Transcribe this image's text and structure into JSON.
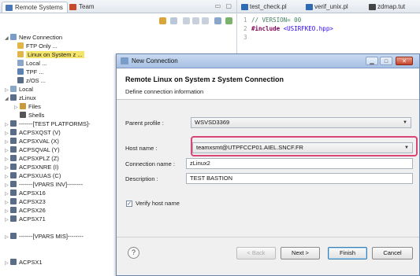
{
  "left_panel": {
    "tabs": [
      "Remote Systems",
      "Team"
    ],
    "tree": [
      {
        "label": "New Connection",
        "icon": "connection-icon"
      },
      {
        "label": "FTP Only ...",
        "icon": "folder-icon"
      },
      {
        "label": "Linux on System z ...",
        "icon": "folder-icon",
        "selected": true
      },
      {
        "label": "Local ...",
        "icon": "local-icon"
      },
      {
        "label": "TPF ...",
        "icon": "tpf-icon"
      },
      {
        "label": "z/OS ...",
        "icon": "system-icon"
      },
      {
        "label": "Local",
        "icon": "local-icon"
      },
      {
        "label": "zLinux",
        "icon": "system-icon"
      },
      {
        "label": "Files",
        "icon": "files-icon"
      },
      {
        "label": "Shells",
        "icon": "shells-icon"
      },
      {
        "label": "-------[TEST PLATFORMS]-",
        "icon": "system-icon"
      },
      {
        "label": "ACPSXQST (V)",
        "icon": "system-icon"
      },
      {
        "label": "ACPSXVAL (X)",
        "icon": "system-icon"
      },
      {
        "label": "ACPSQVAL (Y)",
        "icon": "system-icon"
      },
      {
        "label": "ACPSXPLZ (Z)",
        "icon": "system-icon"
      },
      {
        "label": "ACPSXNRE (I)",
        "icon": "system-icon"
      },
      {
        "label": "ACPSXUAS (C)",
        "icon": "system-icon"
      },
      {
        "label": "-------[VPARS INV]--------",
        "icon": "system-icon"
      },
      {
        "label": "ACPSX16",
        "icon": "system-icon"
      },
      {
        "label": "ACPSX23",
        "icon": "system-icon"
      },
      {
        "label": "ACPSX26",
        "icon": "system-icon"
      },
      {
        "label": "ACPSX71",
        "icon": "system-icon"
      },
      {
        "label": "-------[VPARS MIS]--------",
        "icon": "system-icon"
      },
      {
        "label": "ACPSX1",
        "icon": "system-icon"
      }
    ]
  },
  "editor": {
    "tabs": [
      "test_check.pl",
      "verif_unix.pl",
      "zdmap.tut"
    ],
    "lines": [
      {
        "num": "1",
        "text": "// VERSION= 00"
      },
      {
        "num": "2",
        "keyword": "#include",
        "include": "<USIRFKEO.hpp>"
      },
      {
        "num": "3",
        "text": ""
      }
    ]
  },
  "dialog": {
    "title": "New Connection",
    "banner_title": "Remote Linux on System z System Connection",
    "banner_subtitle": "Define connection information",
    "parent_profile_label": "Parent profile :",
    "parent_profile_value": "WSVSD3369",
    "host_name_label": "Host name :",
    "host_name_value": "teamxsmt@UTPFCCP01.AIEL.SNCF.FR",
    "connection_name_label": "Connection name :",
    "connection_name_value": "zLinux2",
    "description_label": "Description :",
    "description_value": "TEST BASTION",
    "verify_label": "Verify host name",
    "verify_checked": true,
    "buttons": {
      "back": "< Back",
      "next": "Next >",
      "finish": "Finish",
      "cancel": "Cancel",
      "help": "?"
    }
  },
  "colors": {
    "highlight": "#d94575",
    "title_bar": "#a7c0e4",
    "selection": "#f5e56b"
  }
}
